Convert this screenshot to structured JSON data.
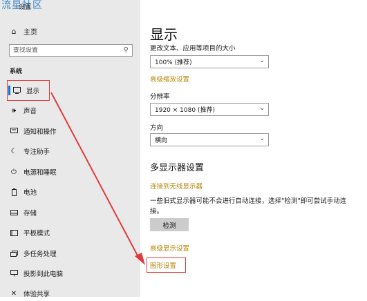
{
  "watermark": "流星社区",
  "window": {
    "title": "设置"
  },
  "sidebar": {
    "home_label": "主页",
    "search_placeholder": "查找设置",
    "section_label": "系统",
    "items": [
      {
        "label": "显示",
        "icon": "monitor-icon",
        "active": true
      },
      {
        "label": "声音",
        "icon": "speaker-icon"
      },
      {
        "label": "通知和操作",
        "icon": "notification-icon"
      },
      {
        "label": "专注助手",
        "icon": "moon-icon"
      },
      {
        "label": "电源和睡眠",
        "icon": "power-icon"
      },
      {
        "label": "电池",
        "icon": "battery-icon"
      },
      {
        "label": "存储",
        "icon": "storage-icon"
      },
      {
        "label": "平板模式",
        "icon": "tablet-icon"
      },
      {
        "label": "多任务处理",
        "icon": "multitask-icon"
      },
      {
        "label": "投影到此电脑",
        "icon": "projection-icon"
      },
      {
        "label": "体验共享",
        "icon": "share-icon"
      }
    ]
  },
  "main": {
    "title": "显示",
    "scale_label": "更改文本、应用等项目的大小",
    "scale_value": "100% (推荐)",
    "advanced_scaling_link": "高级缩放设置",
    "resolution_label": "分辨率",
    "resolution_value": "1920 × 1080 (推荐)",
    "orientation_label": "方向",
    "orientation_value": "横向",
    "multi_display_heading": "多显示器设置",
    "wireless_link": "连接到无线显示器",
    "detect_text": "一些旧式显示器可能不会进行自动连接，选择\"检测\"即可尝试手动连接。",
    "detect_button": "检测",
    "advanced_display_link": "高级显示设置",
    "graphics_link": "图形设置"
  },
  "annotation_color": "#e23b3b",
  "accent_color": "#0078d7",
  "link_color": "#b8860b"
}
